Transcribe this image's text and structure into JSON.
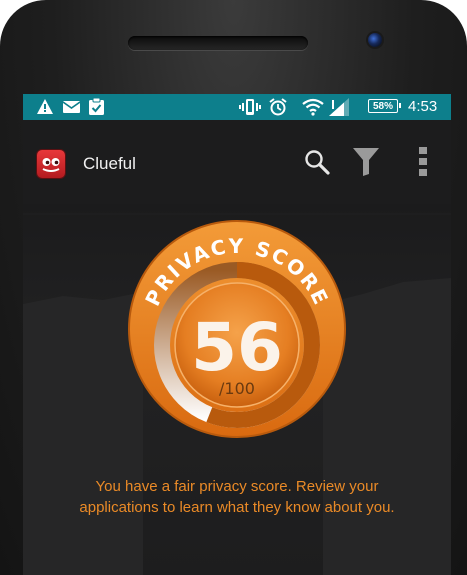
{
  "status_bar": {
    "left_icons": [
      "warning-icon",
      "mail-icon",
      "clipboard-icon"
    ],
    "right_icons": [
      "vibrate-icon",
      "alarm-icon",
      "wifi-icon",
      "signal-icon"
    ],
    "battery": "58%",
    "time": "4:53"
  },
  "action_bar": {
    "app_icon": "clueful-app-icon",
    "title": "Clueful",
    "actions": [
      "search-icon",
      "filter-icon",
      "overflow-menu-icon"
    ]
  },
  "score": {
    "title": "PRIVACY SCORE",
    "value": "56",
    "max": "/100",
    "fraction": 0.56
  },
  "message": "You have a fair privacy score. Review your applications to learn what they know about you.",
  "colors": {
    "status_bar": "#0d7f8c",
    "accent_orange": "#ef7d1d",
    "message_text": "#ea8a27",
    "background": "#1c1c1d"
  }
}
